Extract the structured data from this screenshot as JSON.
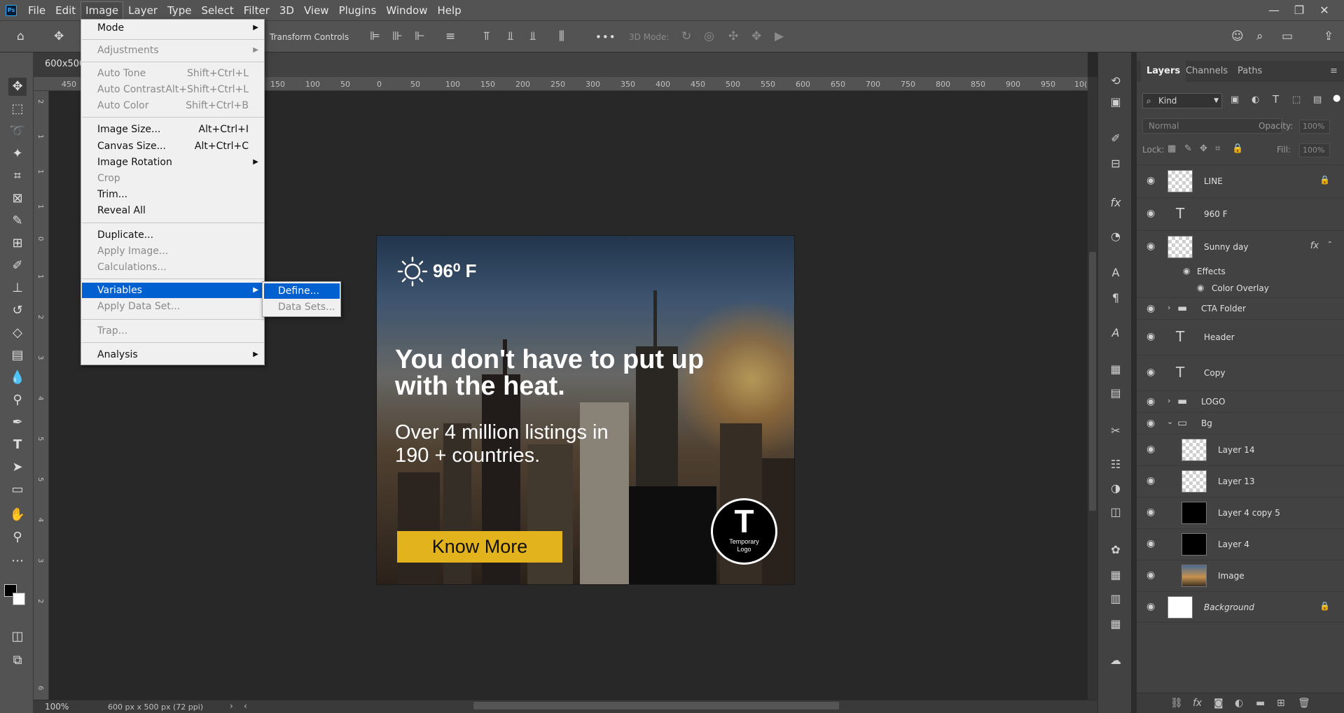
{
  "menubar": {
    "app_logo": "Ps",
    "items": [
      "File",
      "Edit",
      "Image",
      "Layer",
      "Type",
      "Select",
      "Filter",
      "3D",
      "View",
      "Plugins",
      "Window",
      "Help"
    ],
    "active": "Image",
    "window_controls": [
      "—",
      "❐",
      "✕"
    ]
  },
  "options_bar": {
    "transform_controls": "Transform Controls",
    "three_d_mode": "3D Mode:",
    "more": "•••"
  },
  "document": {
    "tab_title": "600x500",
    "zoom": "100%",
    "dimensions": "600 px x 500 px (72 ppi)"
  },
  "ruler": {
    "top_ticks": [
      "450",
      "150",
      "100",
      "50",
      "0",
      "50",
      "100",
      "150",
      "200",
      "250",
      "300",
      "350",
      "400",
      "450",
      "500",
      "550",
      "600",
      "650",
      "700",
      "750",
      "800",
      "850",
      "900",
      "950",
      "10("
    ],
    "left_ticks": [
      "2",
      "1",
      "1",
      "1",
      "0",
      "1",
      "2",
      "3",
      "4",
      "5",
      "5",
      "4",
      "3",
      "2",
      "6"
    ]
  },
  "ad": {
    "temperature": "96⁰ F",
    "headline": "You don't have to put up with the heat.",
    "subline": "Over 4 million listings in 190 + countries.",
    "cta": "Know More",
    "logo_letter": "T",
    "logo_text": "Temporary Logo"
  },
  "image_menu": {
    "items": [
      {
        "label": "Mode",
        "shortcut": "",
        "submenu": true,
        "disabled": false
      },
      {
        "label": "Adjustments",
        "shortcut": "",
        "submenu": true,
        "disabled": true
      },
      {
        "label": "Auto Tone",
        "shortcut": "Shift+Ctrl+L",
        "submenu": false,
        "disabled": true
      },
      {
        "label": "Auto Contrast",
        "shortcut": "Alt+Shift+Ctrl+L",
        "submenu": false,
        "disabled": true
      },
      {
        "label": "Auto Color",
        "shortcut": "Shift+Ctrl+B",
        "submenu": false,
        "disabled": true
      },
      {
        "label": "Image Size...",
        "shortcut": "Alt+Ctrl+I",
        "submenu": false,
        "disabled": false
      },
      {
        "label": "Canvas Size...",
        "shortcut": "Alt+Ctrl+C",
        "submenu": false,
        "disabled": false
      },
      {
        "label": "Image Rotation",
        "shortcut": "",
        "submenu": true,
        "disabled": false
      },
      {
        "label": "Crop",
        "shortcut": "",
        "submenu": false,
        "disabled": true
      },
      {
        "label": "Trim...",
        "shortcut": "",
        "submenu": false,
        "disabled": false
      },
      {
        "label": "Reveal All",
        "shortcut": "",
        "submenu": false,
        "disabled": false
      },
      {
        "label": "Duplicate...",
        "shortcut": "",
        "submenu": false,
        "disabled": false
      },
      {
        "label": "Apply Image...",
        "shortcut": "",
        "submenu": false,
        "disabled": true
      },
      {
        "label": "Calculations...",
        "shortcut": "",
        "submenu": false,
        "disabled": true
      },
      {
        "label": "Variables",
        "shortcut": "",
        "submenu": true,
        "disabled": false,
        "selected": true
      },
      {
        "label": "Apply Data Set...",
        "shortcut": "",
        "submenu": false,
        "disabled": true
      },
      {
        "label": "Trap...",
        "shortcut": "",
        "submenu": false,
        "disabled": true
      },
      {
        "label": "Analysis",
        "shortcut": "",
        "submenu": true,
        "disabled": false
      }
    ]
  },
  "variables_submenu": {
    "items": [
      {
        "label": "Define...",
        "selected": true,
        "disabled": false
      },
      {
        "label": "Data Sets...",
        "selected": false,
        "disabled": true
      }
    ]
  },
  "layers_panel": {
    "tabs": [
      "Layers",
      "Channels",
      "Paths"
    ],
    "active_tab": "Layers",
    "filter_kind": "Kind",
    "blend_mode": "Normal",
    "opacity_label": "Opacity:",
    "opacity_value": "100%",
    "lock_label": "Lock:",
    "fill_label": "Fill:",
    "fill_value": "100%",
    "layers": [
      {
        "name": "LINE",
        "kind": "pixel",
        "thumb": "checker",
        "locked": true
      },
      {
        "name": "960 F",
        "kind": "text"
      },
      {
        "name": "Sunny day",
        "kind": "smart",
        "thumb": "checker",
        "fx": true
      },
      {
        "name": "Effects",
        "kind": "effect-group"
      },
      {
        "name": "Color Overlay",
        "kind": "effect"
      },
      {
        "name": "CTA Folder",
        "kind": "group",
        "expanded": false
      },
      {
        "name": "Header",
        "kind": "text"
      },
      {
        "name": "Copy",
        "kind": "text"
      },
      {
        "name": "LOGO",
        "kind": "group",
        "expanded": false
      },
      {
        "name": "Bg",
        "kind": "group",
        "expanded": true
      },
      {
        "name": "Layer 14",
        "kind": "pixel",
        "thumb": "checker"
      },
      {
        "name": "Layer 13",
        "kind": "pixel",
        "thumb": "checker"
      },
      {
        "name": "Layer 4 copy 5",
        "kind": "pixel",
        "thumb": "black"
      },
      {
        "name": "Layer 4",
        "kind": "pixel",
        "thumb": "black"
      },
      {
        "name": "Image",
        "kind": "pixel",
        "thumb": "photo"
      },
      {
        "name": "Background",
        "kind": "pixel",
        "thumb": "white",
        "locked": true,
        "italic": true
      }
    ],
    "fx_label": "fx"
  },
  "colors": {
    "accent_blue": "#0060d0",
    "cta_yellow": "#e3b31e",
    "chrome_dark": "#535353"
  }
}
